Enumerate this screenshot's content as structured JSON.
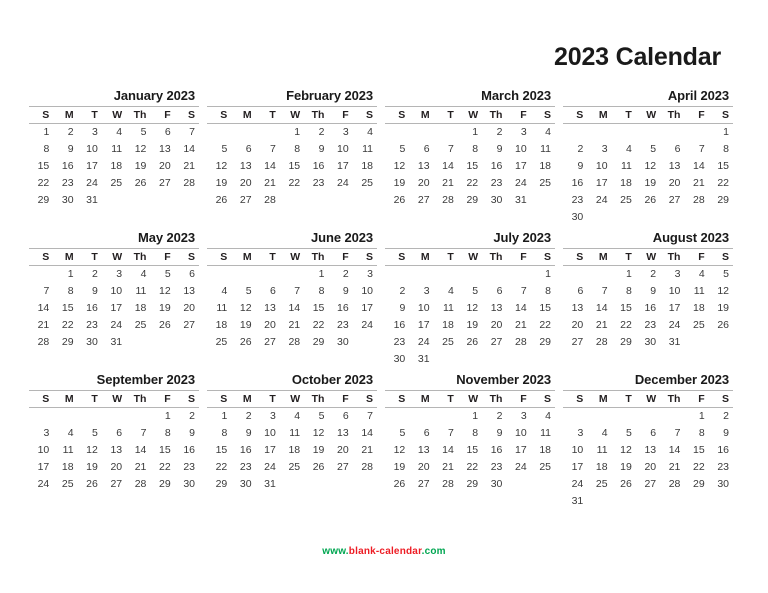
{
  "page": {
    "title": "2023 Calendar",
    "year": "2023"
  },
  "weekday_headers": [
    "S",
    "M",
    "T",
    "W",
    "Th",
    "F",
    "S"
  ],
  "footer": {
    "prefix": "www.",
    "name": "blank-calendar",
    "suffix": ".com",
    "prefix_color": "#00a651",
    "name_color": "#ed1c24",
    "suffix_color": "#00a651"
  },
  "months": [
    {
      "name": "January 2023",
      "month_label": "January",
      "first_weekday_index": 0,
      "num_days": 31,
      "weeks": [
        [
          "1",
          "2",
          "3",
          "4",
          "5",
          "6",
          "7"
        ],
        [
          "8",
          "9",
          "10",
          "11",
          "12",
          "13",
          "14"
        ],
        [
          "15",
          "16",
          "17",
          "18",
          "19",
          "20",
          "21"
        ],
        [
          "22",
          "23",
          "24",
          "25",
          "26",
          "27",
          "28"
        ],
        [
          "29",
          "30",
          "31",
          "",
          "",
          "",
          ""
        ]
      ]
    },
    {
      "name": "February 2023",
      "month_label": "February",
      "first_weekday_index": 3,
      "num_days": 28,
      "weeks": [
        [
          "",
          "",
          "",
          "1",
          "2",
          "3",
          "4"
        ],
        [
          "5",
          "6",
          "7",
          "8",
          "9",
          "10",
          "11"
        ],
        [
          "12",
          "13",
          "14",
          "15",
          "16",
          "17",
          "18"
        ],
        [
          "19",
          "20",
          "21",
          "22",
          "23",
          "24",
          "25"
        ],
        [
          "26",
          "27",
          "28",
          "",
          "",
          "",
          ""
        ]
      ]
    },
    {
      "name": "March 2023",
      "month_label": "March",
      "first_weekday_index": 3,
      "num_days": 31,
      "weeks": [
        [
          "",
          "",
          "",
          "1",
          "2",
          "3",
          "4"
        ],
        [
          "5",
          "6",
          "7",
          "8",
          "9",
          "10",
          "11"
        ],
        [
          "12",
          "13",
          "14",
          "15",
          "16",
          "17",
          "18"
        ],
        [
          "19",
          "20",
          "21",
          "22",
          "23",
          "24",
          "25"
        ],
        [
          "26",
          "27",
          "28",
          "29",
          "30",
          "31",
          ""
        ]
      ]
    },
    {
      "name": "April 2023",
      "month_label": "April",
      "first_weekday_index": 6,
      "num_days": 30,
      "weeks": [
        [
          "",
          "",
          "",
          "",
          "",
          "",
          "1"
        ],
        [
          "2",
          "3",
          "4",
          "5",
          "6",
          "7",
          "8"
        ],
        [
          "9",
          "10",
          "11",
          "12",
          "13",
          "14",
          "15"
        ],
        [
          "16",
          "17",
          "18",
          "19",
          "20",
          "21",
          "22"
        ],
        [
          "23",
          "24",
          "25",
          "26",
          "27",
          "28",
          "29"
        ],
        [
          "30",
          "",
          "",
          "",
          "",
          "",
          ""
        ]
      ]
    },
    {
      "name": "May 2023",
      "month_label": "May",
      "first_weekday_index": 1,
      "num_days": 31,
      "weeks": [
        [
          "",
          "1",
          "2",
          "3",
          "4",
          "5",
          "6"
        ],
        [
          "7",
          "8",
          "9",
          "10",
          "11",
          "12",
          "13"
        ],
        [
          "14",
          "15",
          "16",
          "17",
          "18",
          "19",
          "20"
        ],
        [
          "21",
          "22",
          "23",
          "24",
          "25",
          "26",
          "27"
        ],
        [
          "28",
          "29",
          "30",
          "31",
          "",
          "",
          ""
        ]
      ]
    },
    {
      "name": "June 2023",
      "month_label": "June",
      "first_weekday_index": 4,
      "num_days": 30,
      "weeks": [
        [
          "",
          "",
          "",
          "",
          "1",
          "2",
          "3"
        ],
        [
          "4",
          "5",
          "6",
          "7",
          "8",
          "9",
          "10"
        ],
        [
          "11",
          "12",
          "13",
          "14",
          "15",
          "16",
          "17"
        ],
        [
          "18",
          "19",
          "20",
          "21",
          "22",
          "23",
          "24"
        ],
        [
          "25",
          "26",
          "27",
          "28",
          "29",
          "30",
          ""
        ]
      ]
    },
    {
      "name": "July 2023",
      "month_label": "July",
      "first_weekday_index": 6,
      "num_days": 31,
      "weeks": [
        [
          "",
          "",
          "",
          "",
          "",
          "",
          "1"
        ],
        [
          "2",
          "3",
          "4",
          "5",
          "6",
          "7",
          "8"
        ],
        [
          "9",
          "10",
          "11",
          "12",
          "13",
          "14",
          "15"
        ],
        [
          "16",
          "17",
          "18",
          "19",
          "20",
          "21",
          "22"
        ],
        [
          "23",
          "24",
          "25",
          "26",
          "27",
          "28",
          "29"
        ],
        [
          "30",
          "31",
          "",
          "",
          "",
          "",
          ""
        ]
      ]
    },
    {
      "name": "August 2023",
      "month_label": "August",
      "first_weekday_index": 2,
      "num_days": 31,
      "weeks": [
        [
          "",
          "",
          "1",
          "2",
          "3",
          "4",
          "5"
        ],
        [
          "6",
          "7",
          "8",
          "9",
          "10",
          "11",
          "12"
        ],
        [
          "13",
          "14",
          "15",
          "16",
          "17",
          "18",
          "19"
        ],
        [
          "20",
          "21",
          "22",
          "23",
          "24",
          "25",
          "26"
        ],
        [
          "27",
          "28",
          "29",
          "30",
          "31",
          "",
          ""
        ]
      ]
    },
    {
      "name": "September 2023",
      "month_label": "September",
      "first_weekday_index": 5,
      "num_days": 30,
      "weeks": [
        [
          "",
          "",
          "",
          "",
          "",
          "1",
          "2"
        ],
        [
          "3",
          "4",
          "5",
          "6",
          "7",
          "8",
          "9"
        ],
        [
          "10",
          "11",
          "12",
          "13",
          "14",
          "15",
          "16"
        ],
        [
          "17",
          "18",
          "19",
          "20",
          "21",
          "22",
          "23"
        ],
        [
          "24",
          "25",
          "26",
          "27",
          "28",
          "29",
          "30"
        ]
      ]
    },
    {
      "name": "October 2023",
      "month_label": "October",
      "first_weekday_index": 0,
      "num_days": 31,
      "weeks": [
        [
          "1",
          "2",
          "3",
          "4",
          "5",
          "6",
          "7"
        ],
        [
          "8",
          "9",
          "10",
          "11",
          "12",
          "13",
          "14"
        ],
        [
          "15",
          "16",
          "17",
          "18",
          "19",
          "20",
          "21"
        ],
        [
          "22",
          "23",
          "24",
          "25",
          "26",
          "27",
          "28"
        ],
        [
          "29",
          "30",
          "31",
          "",
          "",
          "",
          ""
        ]
      ]
    },
    {
      "name": "November 2023",
      "month_label": "November",
      "first_weekday_index": 3,
      "num_days": 30,
      "weeks": [
        [
          "",
          "",
          "",
          "1",
          "2",
          "3",
          "4"
        ],
        [
          "5",
          "6",
          "7",
          "8",
          "9",
          "10",
          "11"
        ],
        [
          "12",
          "13",
          "14",
          "15",
          "16",
          "17",
          "18"
        ],
        [
          "19",
          "20",
          "21",
          "22",
          "23",
          "24",
          "25"
        ],
        [
          "26",
          "27",
          "28",
          "29",
          "30",
          "",
          ""
        ]
      ]
    },
    {
      "name": "December 2023",
      "month_label": "December",
      "first_weekday_index": 5,
      "num_days": 31,
      "weeks": [
        [
          "",
          "",
          "",
          "",
          "",
          "1",
          "2"
        ],
        [
          "3",
          "4",
          "5",
          "6",
          "7",
          "8",
          "9"
        ],
        [
          "10",
          "11",
          "12",
          "13",
          "14",
          "15",
          "16"
        ],
        [
          "17",
          "18",
          "19",
          "20",
          "21",
          "22",
          "23"
        ],
        [
          "24",
          "25",
          "26",
          "27",
          "28",
          "29",
          "30"
        ],
        [
          "31",
          "",
          "",
          "",
          "",
          "",
          ""
        ]
      ]
    }
  ]
}
